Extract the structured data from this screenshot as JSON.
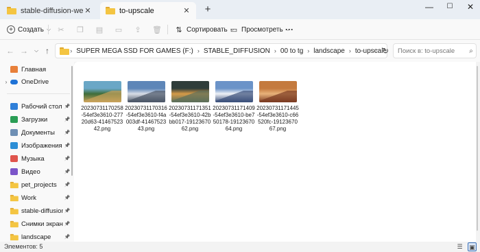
{
  "tabs": [
    {
      "label": "stable-diffusion-webui-xl",
      "active": false
    },
    {
      "label": "to-upscale",
      "active": true
    }
  ],
  "window_controls": {
    "minimize": "—",
    "maximize": "☐",
    "close": "✕"
  },
  "toolbar": {
    "create_label": "Создать",
    "sort_label": "Сортировать",
    "view_label": "Просмотреть",
    "more_label": "···"
  },
  "breadcrumb": [
    "SUPER MEGA SSD FOR GAMES (F:)",
    "STABLE_DIFFUSION",
    "00 to tg",
    "landscape",
    "to-upscale"
  ],
  "search": {
    "placeholder": "Поиск в: to-upscale"
  },
  "sidebar": {
    "top": [
      {
        "label": "Главная",
        "icon": "home-icon",
        "color": "#e8803a"
      },
      {
        "label": "OneDrive",
        "icon": "cloud-icon",
        "color": "#1e72d6"
      }
    ],
    "pinned": [
      {
        "label": "Рабочий стол",
        "icon": "desktop-icon",
        "color": "#2f7fd8"
      },
      {
        "label": "Загрузки",
        "icon": "downloads-icon",
        "color": "#2a9d55"
      },
      {
        "label": "Документы",
        "icon": "documents-icon",
        "color": "#6e8fb4"
      },
      {
        "label": "Изображения",
        "icon": "pictures-icon",
        "color": "#2c8ed6"
      },
      {
        "label": "Музыка",
        "icon": "music-icon",
        "color": "#e0554d"
      },
      {
        "label": "Видео",
        "icon": "video-icon",
        "color": "#7b55c9"
      },
      {
        "label": "pet_projects",
        "icon": "folder-icon",
        "color": "#f4c542"
      },
      {
        "label": "Work",
        "icon": "folder-icon",
        "color": "#f4c542"
      },
      {
        "label": "stable-diffusion-w...",
        "icon": "folder-icon",
        "color": "#f4c542"
      },
      {
        "label": "Снимки экрана",
        "icon": "folder-icon",
        "color": "#f4c542"
      },
      {
        "label": "landscape",
        "icon": "folder-icon",
        "color": "#f4c542"
      }
    ]
  },
  "files": [
    {
      "name": "20230731170258-54ef3e3610-27720d63-4146752342.png",
      "palette": [
        "#6aa7c6",
        "#3f6d3a",
        "#c9a25a"
      ]
    },
    {
      "name": "20230731170316-54ef3e3610-f4a003df-4146752343.png",
      "palette": [
        "#5e86b8",
        "#d8dde6",
        "#4a5566"
      ]
    },
    {
      "name": "20230731171351-54ef3e3610-42bbb017-1912367062.png",
      "palette": [
        "#2f3d3a",
        "#d59a48",
        "#5c6f5a"
      ]
    },
    {
      "name": "20230731171409-54ef3e3610-be750178-1912367064.png",
      "palette": [
        "#6b93c8",
        "#eef1f6",
        "#3a4f7a"
      ]
    },
    {
      "name": "20230731171445-54ef3e3610-c66520fc-1912367067.png",
      "palette": [
        "#c47a3e",
        "#e8b27a",
        "#7b3b22"
      ]
    }
  ],
  "status": {
    "count_label": "Элементов: 5"
  }
}
